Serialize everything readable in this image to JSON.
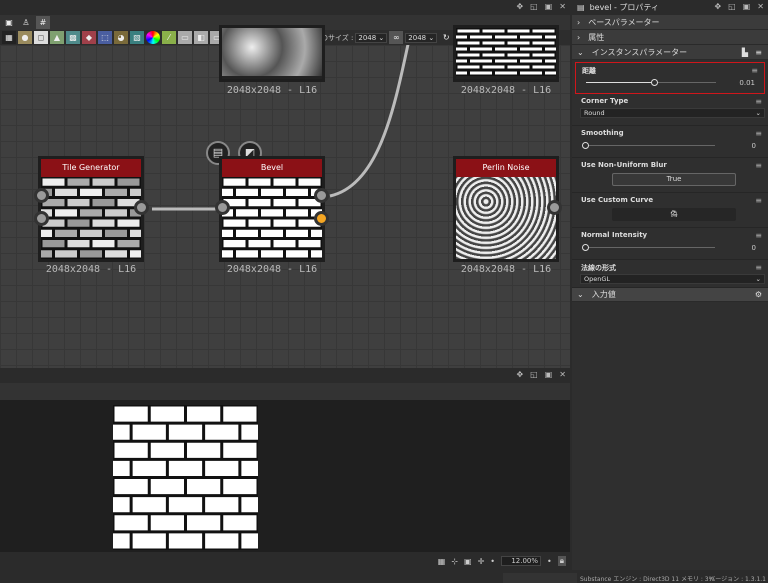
{
  "graph": {
    "toolbar_view_size_label": "親のサイズ :",
    "width_value": "2048",
    "height_value": "2048",
    "nodes": [
      {
        "title": "",
        "resolution": "2048x2048 - L16"
      },
      {
        "title": "",
        "resolution": "2048x2048 - L16"
      },
      {
        "title": "Tile Generator",
        "resolution": "2048x2048 - L16"
      },
      {
        "title": "Bevel",
        "resolution": "2048x2048 - L16"
      },
      {
        "title": "Perlin Noise",
        "resolution": "2048x2048 - L16"
      }
    ],
    "accent_color": "#8b1116",
    "selected_port_color": "#f5a623"
  },
  "properties": {
    "title": "bevel - プロパティ",
    "sections": {
      "base": "ベースパラメーター",
      "attributes": "属性",
      "instance": "インスタンスパラメーター",
      "inputs": "入力値"
    },
    "params": {
      "distance": {
        "label": "距離",
        "value": "0.01",
        "fraction": 0.52
      },
      "corner_type": {
        "label": "Corner Type",
        "value": "Round"
      },
      "smoothing": {
        "label": "Smoothing",
        "value": "0",
        "fraction": 0
      },
      "non_uniform": {
        "label": "Use Non-Uniform Blur",
        "value": "True"
      },
      "custom_curve": {
        "label": "Use Custom Curve",
        "value": "偽"
      },
      "normal_intensity": {
        "label": "Normal Intensity",
        "value": "0",
        "fraction": 0
      },
      "normal_format": {
        "label": "法線の形式",
        "value": "OpenGL"
      }
    },
    "highlight_color": "#d0161b"
  },
  "viewer": {
    "zoom": "12.00%"
  },
  "status": {
    "engine": "Substance エンジン : Direct3D 11  メモリ : 3%",
    "version": "バージョン : 1.3.1.1"
  }
}
